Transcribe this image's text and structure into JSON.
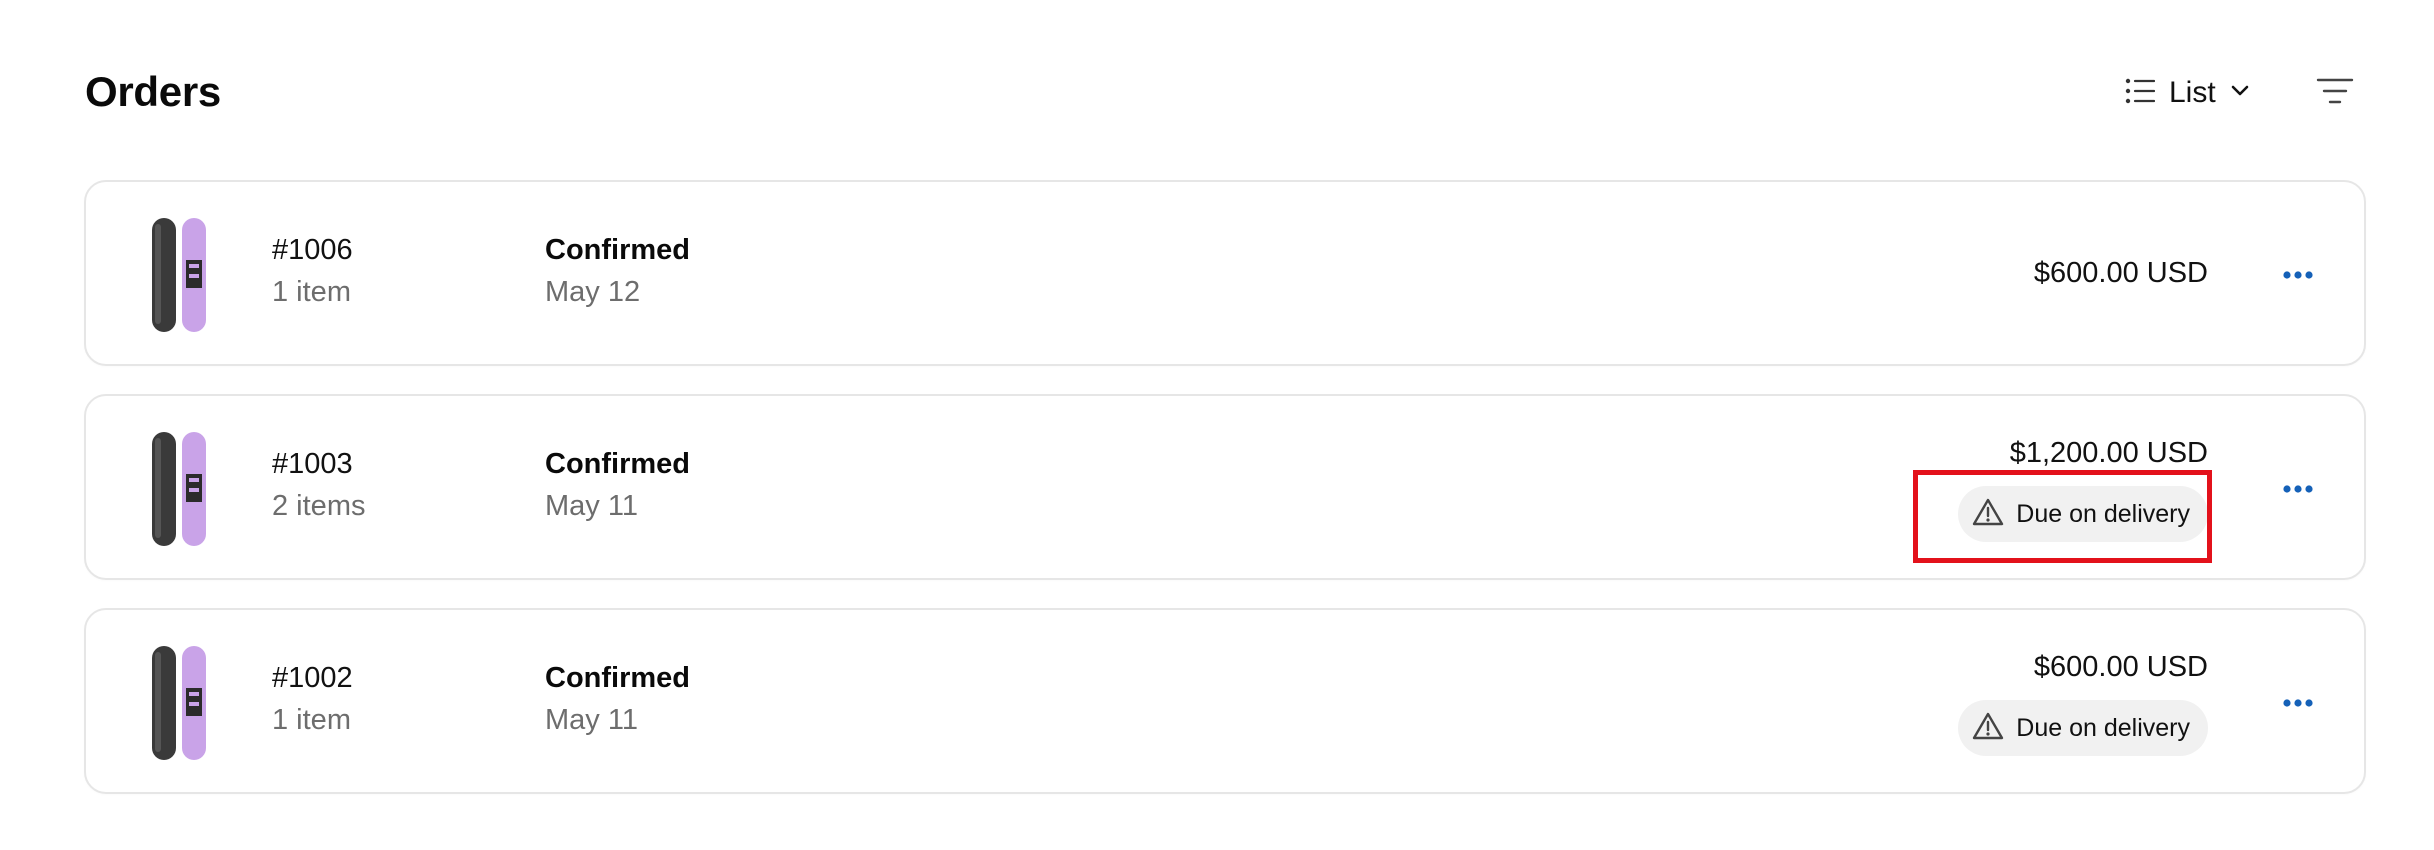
{
  "header": {
    "title": "Orders",
    "view_label": "List",
    "view_icon": "list-icon",
    "view_caret_icon": "chevron-down-icon",
    "filter_icon": "filter-icon"
  },
  "orders": [
    {
      "number": "#1006",
      "items": "1 item",
      "status": "Confirmed",
      "date": "May 12",
      "total": "$600.00 USD",
      "badge": ""
    },
    {
      "number": "#1003",
      "items": "2 items",
      "status": "Confirmed",
      "date": "May 11",
      "total": "$1,200.00 USD",
      "badge": "Due on delivery"
    },
    {
      "number": "#1002",
      "items": "1 item",
      "status": "Confirmed",
      "date": "May 11",
      "total": "$600.00 USD",
      "badge": "Due on delivery"
    }
  ],
  "icons": {
    "warning": "warning-icon",
    "more": "more-horizontal-icon",
    "product": "snowboard-thumbnail"
  },
  "colors": {
    "accent": "#1561b8",
    "highlight": "#e3111b",
    "badge_bg": "#f1f1f1",
    "muted_text": "#6d6d6d"
  }
}
